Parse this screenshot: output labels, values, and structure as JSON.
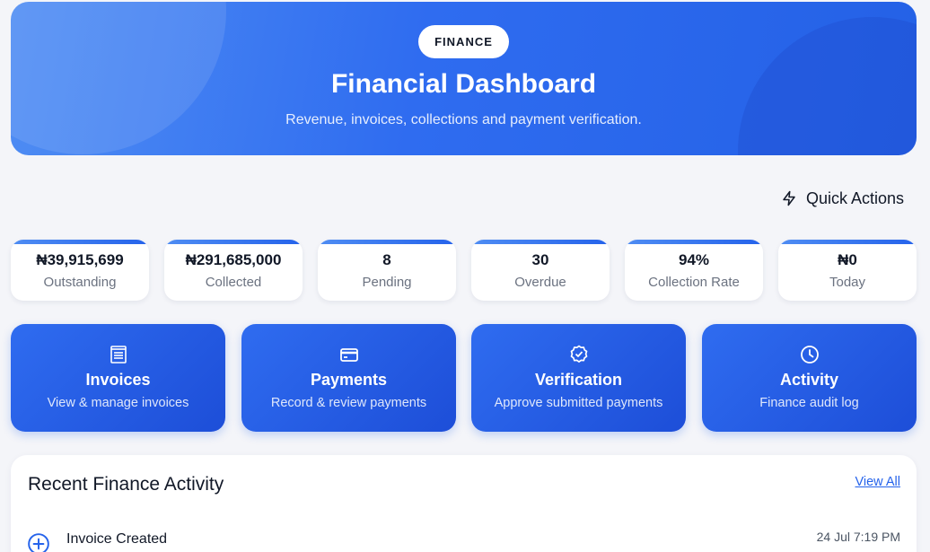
{
  "hero": {
    "badge": "FINANCE",
    "title": "Financial Dashboard",
    "subtitle": "Revenue, invoices, collections and payment verification."
  },
  "quick_actions": {
    "label": "Quick Actions",
    "icon": "lightning-icon"
  },
  "stats": [
    {
      "value": "₦39,915,699",
      "label": "Outstanding"
    },
    {
      "value": "₦291,685,000",
      "label": "Collected"
    },
    {
      "value": "8",
      "label": "Pending"
    },
    {
      "value": "30",
      "label": "Overdue"
    },
    {
      "value": "94%",
      "label": "Collection Rate"
    },
    {
      "value": "₦0",
      "label": "Today"
    }
  ],
  "actions": [
    {
      "title": "Invoices",
      "desc": "View & manage invoices",
      "icon": "invoice-icon"
    },
    {
      "title": "Payments",
      "desc": "Record & review payments",
      "icon": "card-icon"
    },
    {
      "title": "Verification",
      "desc": "Approve submitted payments",
      "icon": "verified-badge-icon"
    },
    {
      "title": "Activity",
      "desc": "Finance audit log",
      "icon": "clock-icon"
    }
  ],
  "recent": {
    "title": "Recent Finance Activity",
    "view_all": "View All",
    "items": [
      {
        "title": "Invoice Created",
        "date": "24 Jul 7:19 PM",
        "icon": "plus-circle-icon"
      }
    ]
  },
  "colors": {
    "primary": "#2563eb",
    "hero_light": "#4f8df3",
    "background": "#f4f5f9"
  }
}
